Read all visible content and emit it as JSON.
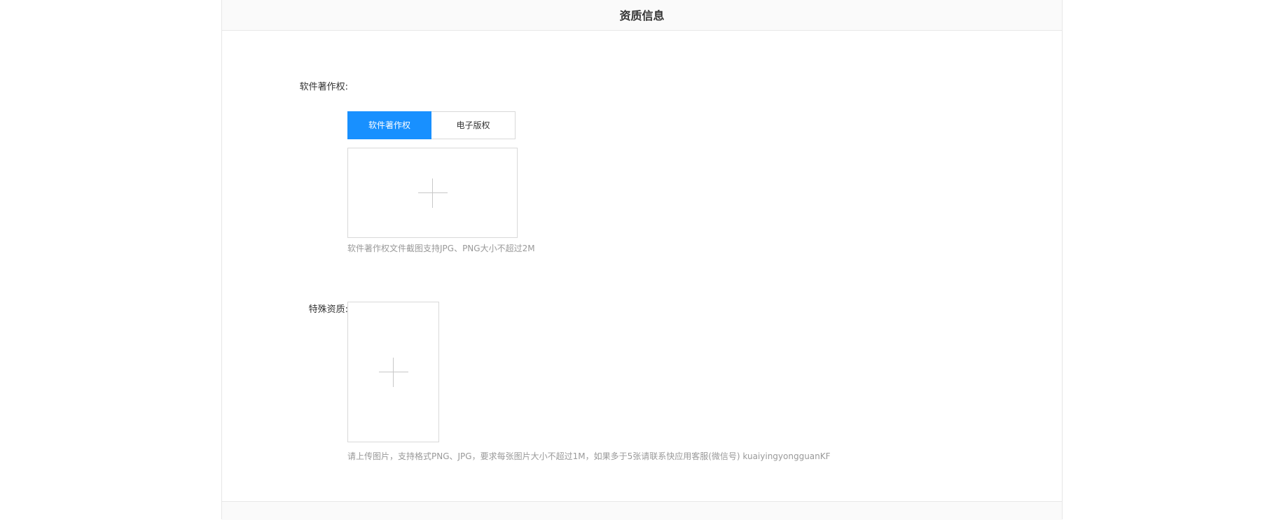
{
  "header": {
    "title": "资质信息"
  },
  "software_copyright": {
    "label": "软件著作权:",
    "tabs": [
      {
        "label": "软件著作权",
        "active": true
      },
      {
        "label": "电子版权",
        "active": false
      }
    ],
    "upload_icon": "plus-icon",
    "hint": "软件著作权文件截图支持JPG、PNG大小不超过2M"
  },
  "special_qualification": {
    "label": "特殊资质:",
    "upload_icon": "plus-icon",
    "hint": "请上传图片，支持格式PNG、JPG，要求每张图片大小不超过1M，如果多于5张请联系快应用客服(微信号) kuaiyingyongguanKF"
  },
  "colors": {
    "accent": "#1890ff",
    "border": "#d9d9d9",
    "hint_text": "#999999"
  }
}
